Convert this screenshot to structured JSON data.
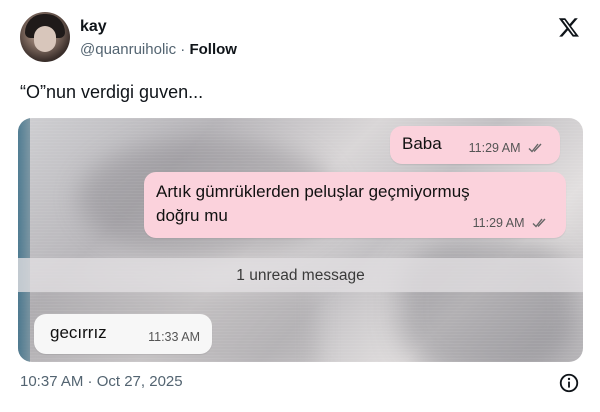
{
  "author": {
    "name": "kay",
    "handle": "@quanruiholic",
    "separator": "·",
    "follow_label": "Follow"
  },
  "tweet": {
    "text": "“O”nun verdigi guven..."
  },
  "chat": {
    "messages": [
      {
        "text": "Baba",
        "time": "11:29 AM"
      },
      {
        "text": "Artık gümrüklerden peluşlar geçmiyormuş doğru mu",
        "time": "11:29 AM"
      },
      {
        "text": "gecırrız",
        "time": "11:33 AM"
      }
    ],
    "unread_divider": "1 unread message"
  },
  "footer": {
    "timestamp": "10:37 AM · Oct 27, 2025"
  },
  "icons": {
    "logo": "x-logo-icon",
    "info": "info-icon",
    "read_receipt": "double-check-icon"
  },
  "colors": {
    "outgoing_bubble": "#fbd2dc",
    "incoming_bubble": "#f7f7f7",
    "text_secondary": "#536471"
  }
}
